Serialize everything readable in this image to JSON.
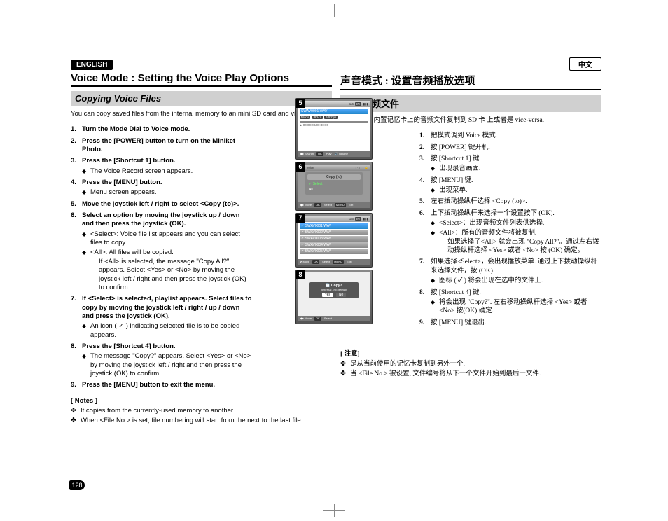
{
  "lang_en": "ENGLISH",
  "lang_cn": "中文",
  "title_en": "Voice Mode : Setting the Voice Play Options",
  "title_cn": "声音模式 : 设置音频播放选项",
  "sub_en": "Copying Voice Files",
  "sub_cn": "复制音频文件",
  "intro_en": "You can copy saved files from the internal memory to an mini SD card and vice-versa.",
  "intro_cn": "可以把存在内置记忆卡上的音频文件复制到 SD 卡 上或者是 vice-versa.",
  "steps_en": {
    "s1": "Turn the Mode Dial to Voice mode.",
    "s2": "Press the [POWER] button to turn on the Miniket Photo.",
    "s3": "Press the [Shortcut 1] button.",
    "s3a": "The Voice Record screen appears.",
    "s4": "Press the [MENU] button.",
    "s4a": "Menu screen appears.",
    "s5": "Move the joystick left / right to select <Copy (to)>.",
    "s6": "Select an option by moving the joystick up / down and then press the joystick (OK).",
    "s6a": "<Select>: Voice file list appears and you can select files to copy.",
    "s6b": "<All>: All files will be copied.",
    "s6b2": "If <All> is selected, the message \"Copy All?\" appears. Select <Yes> or <No> by moving the joystick left / right and then press the joystick (OK) to confirm.",
    "s7": "If <Select> is selected, playlist appears. Select files to copy by moving the joystick left / right / up / down and press the joystick (OK).",
    "s7a": "An icon ( ✓ ) indicating selected file is to be copied appears.",
    "s8": "Press the [Shortcut 4] button.",
    "s8a": "The message \"Copy?\" appears. Select <Yes> or <No> by moving the joystick left / right  and then press the joystick (OK) to confirm.",
    "s9": "Press the [MENU] button to exit the menu."
  },
  "steps_cn": {
    "s1": "把模式调到 Voice 模式.",
    "s2": "按 [POWER] 键开机.",
    "s3": "按 [Shortcut 1] 键.",
    "s3a": "出现录音画面.",
    "s4": "按 [MENU] 键.",
    "s4a": "出现菜单.",
    "s5": "左右拨动操纵杆选择 <Copy (to)>.",
    "s6": "上下拨动操纵杆来选择一个设置按下 (OK).",
    "s6a": "<Select>：出现音频文件列表供选择.",
    "s6b": "<All>：所有的音频文件将被复制.",
    "s6b2": "如果选择了<All> 就会出现 \"Copy All?\"。通过左右拨动操纵杆选择 <Yes> 或者 <No> 按 (OK) 确定。",
    "s7": "如果选择<Select>，会出现播放菜单. 通过上下拨动操纵杆来选择文件，按 (OK).",
    "s7a": "图标 ( ✓ ) 将会出现在选中的文件上.",
    "s8": "按 [Shortcut 4] 键.",
    "s8a": "将会出现 \"Copy?\". 左右移动操纵杆选择 <Yes> 或者 <No> 按(OK) 确定.",
    "s9": "按 [MENU] 键退出."
  },
  "notes_h_en": "[ Notes ]",
  "notes_en": {
    "n1": "It copies from the currently-used memory to another.",
    "n2": "When <File No.> is set, file numbering will start from the next to the last file."
  },
  "notes_h_cn": "[ 注意]",
  "notes_cn": {
    "n1": "是从当前使用的记忆卡复制到另外一个.",
    "n2": "当 <File No.> 被设置, 文件编号将从下一个文件开始到最后一文件."
  },
  "page_num": "128",
  "shots": {
    "file1": "SWAV0001.WAV",
    "file2": "SWAV0002.WAV",
    "file3": "SWAV0003.WAV",
    "file4": "SWAV0004.WAV",
    "file5": "SWAV0005.WAV",
    "mono": "Mono",
    "khz": "8KHz",
    "kbps": "64Kbps",
    "time": "00:00:00/00:30:00",
    "counter1": "1/6",
    "counter2": "1/6",
    "in": "IN",
    "search": "Search",
    "play": "Play",
    "volume": "Volume",
    "move": "Move",
    "select": "Select",
    "ok": "OK",
    "menu": "MENU",
    "exit": "Exit",
    "voice_tab": "Voice",
    "copy_to": "Copy (to)",
    "opt_select": "Select",
    "opt_all": "All",
    "popup_title": "Copy?",
    "popup_sub": "(Internal -> External)",
    "yes": "Yes",
    "no": "No"
  }
}
